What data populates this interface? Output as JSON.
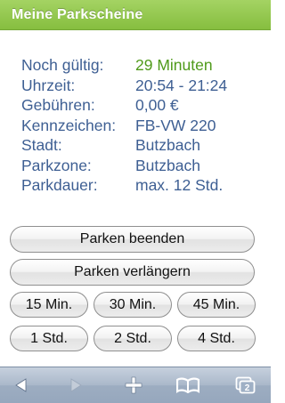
{
  "header": {
    "title": "Meine Parkscheine"
  },
  "info": [
    {
      "label": "Noch gültig:",
      "value": "29 Minuten",
      "highlight": true
    },
    {
      "label": "Uhrzeit:",
      "value": "20:54 - 21:24"
    },
    {
      "label": "Gebühren:",
      "value": "0,00 €"
    },
    {
      "label": "Kennzeichen:",
      "value": "FB-VW 220"
    },
    {
      "label": "Stadt:",
      "value": "Butzbach"
    },
    {
      "label": "Parkzone:",
      "value": "Butzbach"
    },
    {
      "label": "Parkdauer:",
      "value": "max. 12 Std."
    }
  ],
  "actions": {
    "end_label": "Parken beenden",
    "extend_label": "Parken verlängern"
  },
  "durations": [
    "15 Min.",
    "30 Min.",
    "45 Min.",
    "1 Std.",
    "2 Std.",
    "4 Std."
  ],
  "toolbar": {
    "icons": [
      "back-icon",
      "forward-icon",
      "add-icon",
      "bookmarks-icon",
      "tabs-icon"
    ],
    "tabs_count": "2"
  },
  "colors": {
    "header_green": "#8cc447",
    "label_blue": "#3e5f93",
    "value_green": "#4f9a1a",
    "toolbar_blue": "#a6b5c8"
  }
}
